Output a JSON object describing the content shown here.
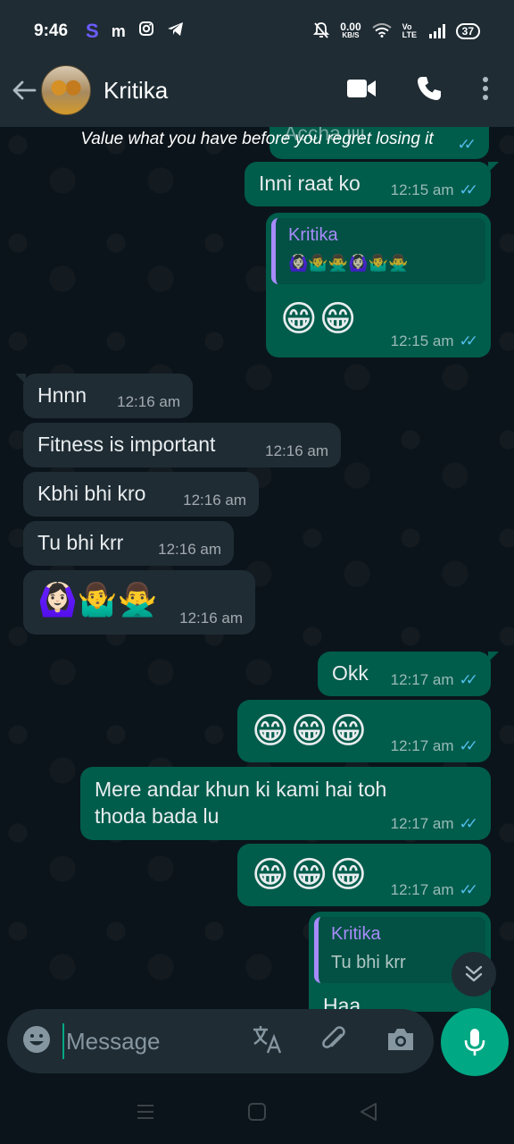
{
  "status_bar": {
    "time": "9:46",
    "app_icons": [
      "S",
      "m"
    ],
    "net_speed": "0.00",
    "net_unit": "KB/S",
    "volte": "Vo LTE",
    "battery": "37"
  },
  "header": {
    "contact_name": "Kritika"
  },
  "chat": {
    "motto": "Value what you have before you regret losing it",
    "partial_top_text": "Accha jiii",
    "messages": [
      {
        "text": "Inni raat ko",
        "time": "12:15 am"
      },
      {
        "quote_name": "Kritika",
        "quote_text": "🙆🏻‍♀️🤷‍♂️🙅‍♂️🙆🏻‍♀️🤷‍♂️🙅‍♂️",
        "text": "😁😁",
        "time": "12:15 am"
      },
      {
        "text": "Hnnn",
        "time": "12:16 am"
      },
      {
        "text": "Fitness is important",
        "time": "12:16 am"
      },
      {
        "text": "Kbhi bhi kro",
        "time": "12:16 am"
      },
      {
        "text": "Tu bhi krr",
        "time": "12:16 am"
      },
      {
        "text": "🙆🏻‍♀️🤷‍♂️🙅‍♂️",
        "time": "12:16 am"
      },
      {
        "text": "Okk",
        "time": "12:17 am"
      },
      {
        "text": "😁😁😁",
        "time": "12:17 am"
      },
      {
        "text_line1": "Mere andar khun ki kami hai toh",
        "text_line2": "thoda bada lu",
        "time": "12:17 am"
      },
      {
        "text": "😁😁😁",
        "time": "12:17 am"
      },
      {
        "quote_name": "Kritika",
        "quote_text": "Tu bhi krr",
        "partial_text": "Haa"
      }
    ]
  },
  "input": {
    "placeholder": "Message"
  },
  "colors": {
    "outgoing_bubble": "#005c4b",
    "incoming_bubble": "#1f2c34",
    "accent": "#00a884",
    "read_ticks": "#53bdeb",
    "quote_name": "#a78bfa"
  },
  "icons": {
    "header": [
      "back-arrow-icon",
      "video-call-icon",
      "voice-call-icon",
      "more-options-icon"
    ],
    "input": [
      "emoji-icon",
      "translate-icon",
      "attach-icon",
      "camera-icon",
      "mic-icon"
    ],
    "nav": [
      "menu-nav-icon",
      "home-nav-icon",
      "back-nav-icon"
    ]
  }
}
